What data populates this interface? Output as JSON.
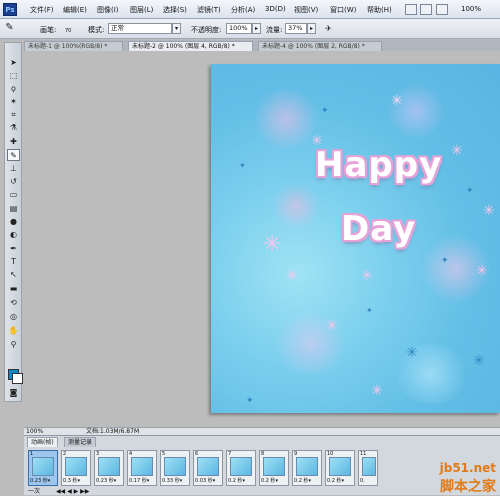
{
  "menubar": {
    "logo": "Ps",
    "items": [
      "文件(F)",
      "编辑(E)",
      "图像(I)",
      "图层(L)",
      "选择(S)",
      "滤镜(T)",
      "分析(A)",
      "3D(D)",
      "视图(V)",
      "窗口(W)",
      "帮助(H)"
    ],
    "zoom": "100%"
  },
  "options": {
    "brush_label": "画笔:",
    "brush_size": "70",
    "mode_label": "模式:",
    "mode_value": "正常",
    "opacity_label": "不透明度:",
    "opacity_value": "100%",
    "flow_label": "流量:",
    "flow_value": "37%"
  },
  "tabs": [
    "未标题-1 @ 100%(RGB/8) *",
    "未标题-2 @ 100% (图层 4, RGB/8) *",
    "未标题-4 @ 100% (图层 2, RGB/8) *"
  ],
  "canvas": {
    "line1": "Happy",
    "line2": "Day",
    "bg_color": "#63bfe6",
    "text_outline_color": "#e7a3d8"
  },
  "status": {
    "zoom": "100%",
    "doc_info": "文档:1.03M/6.87M"
  },
  "animation": {
    "tabs": [
      "动画(帧)",
      "测量记录"
    ],
    "frames": [
      {
        "num": "1",
        "delay": "0.23 秒▾"
      },
      {
        "num": "2",
        "delay": "0.3 秒▾"
      },
      {
        "num": "3",
        "delay": "0.23 秒▾"
      },
      {
        "num": "4",
        "delay": "0.17 秒▾"
      },
      {
        "num": "5",
        "delay": "0.33 秒▾"
      },
      {
        "num": "6",
        "delay": "0.03 秒▾"
      },
      {
        "num": "7",
        "delay": "0.2 秒▾"
      },
      {
        "num": "8",
        "delay": "0.2 秒▾"
      },
      {
        "num": "9",
        "delay": "0.2 秒▾"
      },
      {
        "num": "10",
        "delay": "0.2 秒▾"
      },
      {
        "num": "11",
        "delay": "0."
      }
    ],
    "loop": "一次",
    "controls": "◀◀ ◀ ▶ ▶▶"
  },
  "watermark": {
    "site": "jb51.net",
    "name": "脚本之家"
  }
}
